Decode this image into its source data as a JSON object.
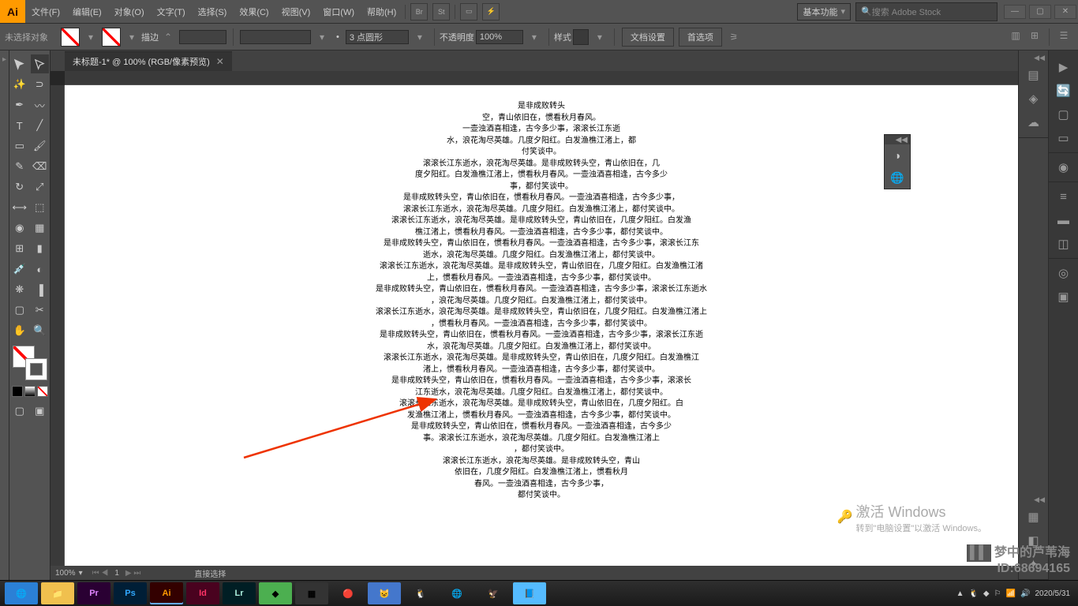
{
  "menubar": {
    "items": [
      "文件(F)",
      "编辑(E)",
      "对象(O)",
      "文字(T)",
      "选择(S)",
      "效果(C)",
      "视图(V)",
      "窗口(W)",
      "帮助(H)"
    ],
    "workspace_label": "基本功能",
    "search_placeholder": "搜索 Adobe Stock"
  },
  "optbar": {
    "noselect": "未选择对象",
    "stroke_label": "描边",
    "stroke_weight": "",
    "brush_val": "",
    "brush_style": "3 点圆形",
    "opacity_label": "不透明度",
    "opacity_val": "100%",
    "style_label": "样式",
    "docset_btn": "文档设置",
    "pref_btn": "首选项"
  },
  "doc": {
    "tab": "未标题-1* @ 100% (RGB/像素预览)",
    "zoom": "100%",
    "page": "1",
    "status": "直接选择"
  },
  "textlines": [
    "是非成败转头",
    "空，青山依旧在，惯看秋月春风。",
    "一壶浊酒喜相逢，古今多少事，滚滚长江东逝",
    "水，浪花淘尽英雄。几度夕阳红。白发渔樵江渚上，都",
    "付笑谈中。",
    "滚滚长江东逝水，浪花淘尽英雄。是非成败转头空，青山依旧在，几",
    "度夕阳红。白发渔樵江渚上，惯看秋月春风。一壶浊酒喜相逢，古今多少",
    "事，都付笑谈中。",
    "是非成败转头空，青山依旧在，惯看秋月春风。一壶浊酒喜相逢，古今多少事，",
    "滚滚长江东逝水，浪花淘尽英雄。几度夕阳红。白发渔樵江渚上，都付笑谈中。",
    "滚滚长江东逝水，浪花淘尽英雄。是非成败转头空，青山依旧在，几度夕阳红。白发渔",
    "樵江渚上，惯看秋月春风。一壶浊酒喜相逢，古今多少事，都付笑谈中。",
    "是非成败转头空，青山依旧在，惯看秋月春风。一壶浊酒喜相逢，古今多少事，滚滚长江东",
    "逝水，浪花淘尽英雄。几度夕阳红。白发渔樵江渚上，都付笑谈中。",
    "滚滚长江东逝水，浪花淘尽英雄。是非成败转头空，青山依旧在，几度夕阳红。白发渔樵江渚",
    "上，惯看秋月春风。一壶浊酒喜相逢，古今多少事，都付笑谈中。",
    "是非成败转头空，青山依旧在，惯看秋月春风。一壶浊酒喜相逢，古今多少事，滚滚长江东逝水",
    "，浪花淘尽英雄。几度夕阳红。白发渔樵江渚上，都付笑谈中。",
    "滚滚长江东逝水，浪花淘尽英雄。是非成败转头空，青山依旧在，几度夕阳红。白发渔樵江渚上",
    "，惯看秋月春风。一壶浊酒喜相逢，古今多少事，都付笑谈中。",
    "是非成败转头空，青山依旧在，惯看秋月春风。一壶浊酒喜相逢，古今多少事，滚滚长江东逝",
    "水，浪花淘尽英雄。几度夕阳红。白发渔樵江渚上，都付笑谈中。",
    "滚滚长江东逝水，浪花淘尽英雄。是非成败转头空，青山依旧在，几度夕阳红。白发渔樵江",
    "渚上，惯看秋月春风。一壶浊酒喜相逢，古今多少事，都付笑谈中。",
    "是非成败转头空，青山依旧在，惯看秋月春风。一壶浊酒喜相逢，古今多少事，滚滚长",
    "江东逝水，浪花淘尽英雄。几度夕阳红。白发渔樵江渚上，都付笑谈中。",
    "滚滚长江东逝水，浪花淘尽英雄。是非成败转头空，青山依旧在，几度夕阳红。白",
    "发渔樵江渚上，惯看秋月春风。一壶浊酒喜相逢，古今多少事，都付笑谈中。",
    "是非成败转头空，青山依旧在，惯看秋月春风。一壶浊酒喜相逢，古今多少",
    "事。滚滚长江东逝水，浪花淘尽英雄。几度夕阳红。白发渔樵江渚上",
    "，都付笑谈中。",
    "滚滚长江东逝水，浪花淘尽英雄。是非成败转头空，青山",
    "依旧在，几度夕阳红。白发渔樵江渚上，惯看秋月",
    "春风。一壶浊酒喜相逢，古今多少事，",
    "都付笑谈中。"
  ],
  "watermark": {
    "line1": "激活 Windows",
    "line2": "转到\"电脑设置\"以激活 Windows。"
  },
  "corner": {
    "l1": "梦中的芦苇海",
    "l2": "ID:68694165"
  },
  "taskbar": {
    "date": "2020/5/31"
  }
}
